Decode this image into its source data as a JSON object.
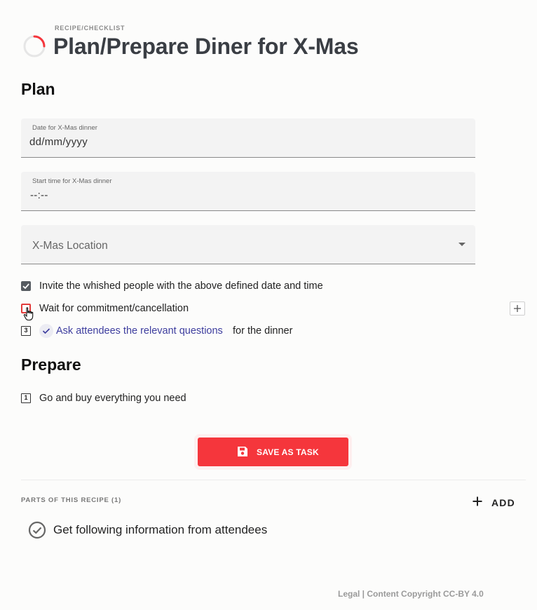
{
  "header": {
    "kicker": "RECIPE/CHECKLIST",
    "title": "Plan/Prepare Diner for X-Mas",
    "spinner_color": "#f5363c"
  },
  "sections": {
    "plan_title": "Plan",
    "prepare_title": "Prepare"
  },
  "fields": {
    "date": {
      "label": "Date for X-Mas dinner",
      "value": "dd/mm/yyyy"
    },
    "time": {
      "label": "Start time for X-Mas dinner",
      "value": "--:--"
    },
    "location": {
      "placeholder": "X-Mas Location"
    }
  },
  "plan_items": [
    {
      "text": "Invite the whished people with the above defined date and time",
      "state": "checked"
    },
    {
      "text": "Wait for commitment/cancellation",
      "state": "focused"
    },
    {
      "number": "3",
      "link_text": "Ask attendees the relevant questions",
      "suffix": "for the dinner",
      "state": "unchecked"
    }
  ],
  "prepare_items": [
    {
      "number": "1",
      "text": "Go and buy everything you need",
      "state": "unchecked"
    }
  ],
  "actions": {
    "save_label": "SAVE AS TASK",
    "add_label": "ADD"
  },
  "parts": {
    "label": "PARTS OF THIS RECIPE (1)",
    "items": [
      {
        "text": "Get following information from attendees"
      }
    ]
  },
  "footer": {
    "text": "Legal | Content Copyright CC-BY 4.0"
  },
  "colors": {
    "accent": "#f5363c",
    "link": "#3d3d9e"
  }
}
